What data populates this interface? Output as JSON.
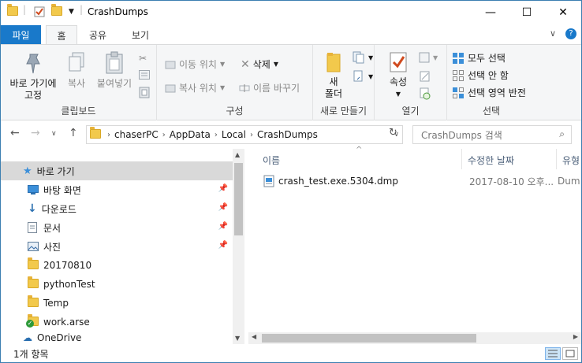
{
  "window": {
    "title": "CrashDumps",
    "minimize": "—",
    "maximize": "☐",
    "close": "✕"
  },
  "ribbon_tabs": {
    "file": "파일",
    "home": "홈",
    "share": "공유",
    "view": "보기"
  },
  "clipboard": {
    "pin_label_1": "바로 가기에",
    "pin_label_2": "고정",
    "copy": "복사",
    "paste": "붙여넣기",
    "group": "클립보드"
  },
  "organize": {
    "move_to": "이동 위치",
    "copy_to": "복사 위치",
    "delete": "삭제",
    "rename": "이름 바꾸기",
    "group": "구성"
  },
  "new": {
    "new_folder_1": "새",
    "new_folder_2": "폴더",
    "group": "새로 만들기"
  },
  "open": {
    "properties": "속성",
    "group": "열기"
  },
  "select": {
    "select_all": "모두 선택",
    "select_none": "선택 안 함",
    "invert": "선택 영역 반전",
    "group": "선택"
  },
  "address": {
    "segments": [
      "chaserPC",
      "AppData",
      "Local",
      "CrashDumps"
    ]
  },
  "search": {
    "placeholder": "CrashDumps 검색"
  },
  "nav": {
    "quick_access": "바로 가기",
    "items": [
      {
        "label": "바탕 화면",
        "pinned": true
      },
      {
        "label": "다운로드",
        "pinned": true
      },
      {
        "label": "문서",
        "pinned": true
      },
      {
        "label": "사진",
        "pinned": true
      },
      {
        "label": "20170810",
        "pinned": false
      },
      {
        "label": "pythonTest",
        "pinned": false
      },
      {
        "label": "Temp",
        "pinned": false
      },
      {
        "label": "work.arse",
        "pinned": false
      }
    ],
    "partial": "OneDrive"
  },
  "columns": {
    "name": "이름",
    "date": "수정한 날짜",
    "type": "유형"
  },
  "files": [
    {
      "name": "crash_test.exe.5304.dmp",
      "date": "2017-08-10 오후...",
      "type": "Dum"
    }
  ],
  "status": {
    "count": "1개 항목"
  }
}
